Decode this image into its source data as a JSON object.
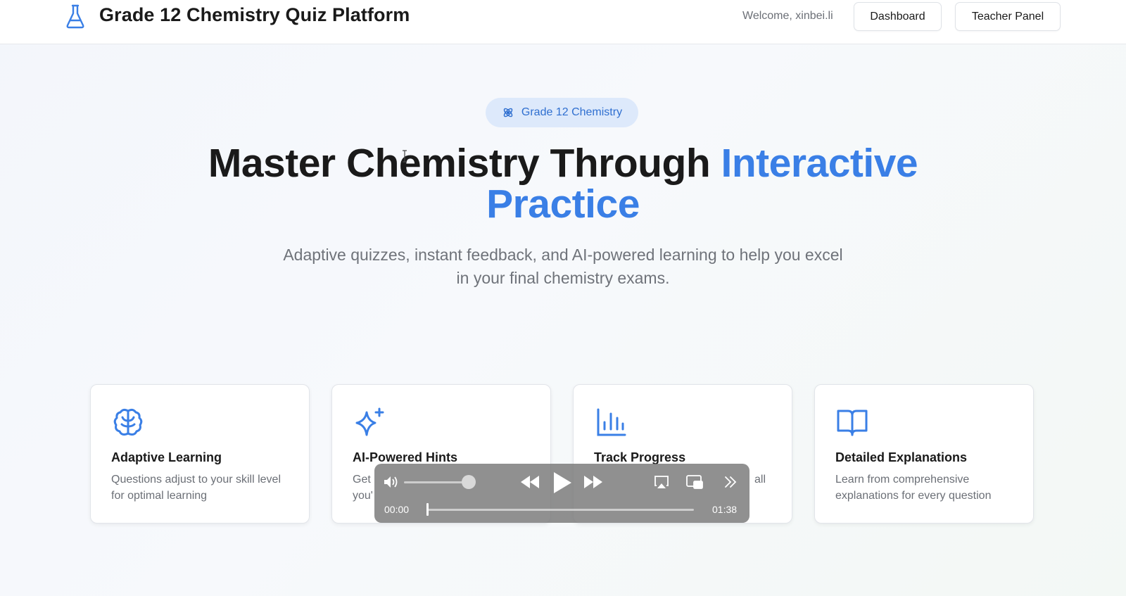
{
  "header": {
    "brand_icon": "flask-icon",
    "title": "Grade 12 Chemistry Quiz Platform",
    "welcome": "Welcome, xinbei.li",
    "nav": {
      "dashboard": "Dashboard",
      "teacher_panel": "Teacher Panel"
    }
  },
  "hero": {
    "badge": {
      "icon": "atom-icon",
      "label": "Grade 12 Chemistry"
    },
    "title_main": "Master Chemistry Through",
    "title_accent": "Interactive Practice",
    "subtitle": "Adaptive quizzes, instant feedback, and AI-powered learning to help you excel in your final chemistry exams."
  },
  "features": [
    {
      "icon": "brain-icon",
      "title": "Adaptive Learning",
      "desc": "Questions adjust to your skill level for optimal learning"
    },
    {
      "icon": "sparkles-icon",
      "title": "AI-Powered Hints",
      "desc_visible_start": "Get",
      "desc_visible_line2": "you'"
    },
    {
      "icon": "bar-chart-icon",
      "title": "Track Progress",
      "desc_visible_end": "all"
    },
    {
      "icon": "book-open-icon",
      "title": "Detailed Explanations",
      "desc": "Learn from comprehensive explanations for every question"
    }
  ],
  "player": {
    "time_current": "00:00",
    "time_total": "01:38",
    "volume": 0.85,
    "progress": 0.0
  },
  "colors": {
    "accent": "#3a7fe6",
    "badge_bg": "#dde9fb",
    "badge_text": "#2f6fd0",
    "text_muted": "#6b6f76"
  }
}
